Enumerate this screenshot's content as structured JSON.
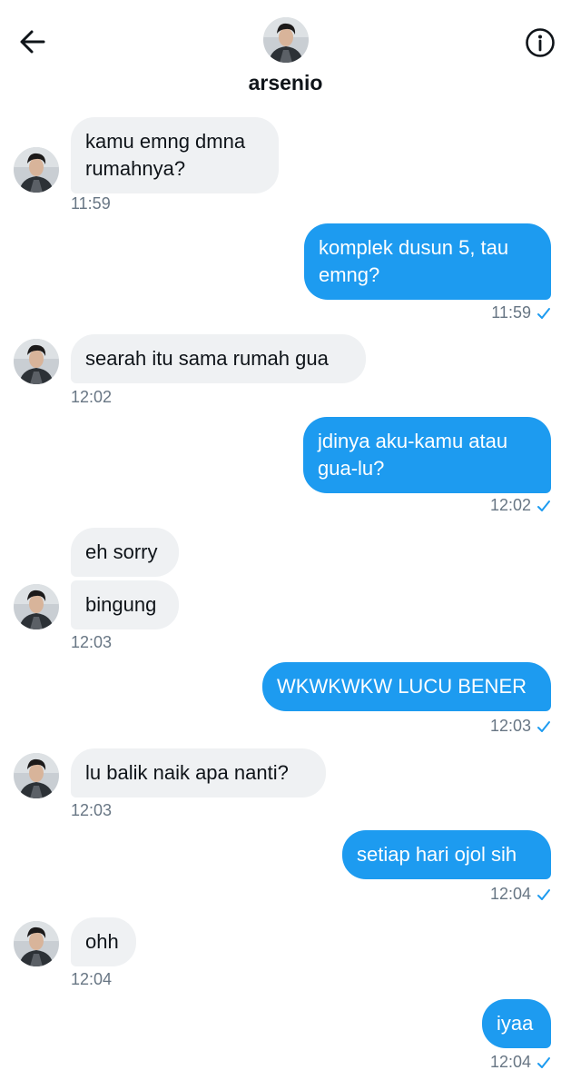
{
  "header": {
    "name": "arsenio"
  },
  "messages": [
    {
      "dir": "in",
      "text": "kamu emng dmna\nrumahnya?",
      "time": "11:59"
    },
    {
      "dir": "out",
      "text": "komplek dusun 5, tau\nemng?",
      "time": "11:59"
    },
    {
      "dir": "in",
      "text": "searah itu sama rumah gua",
      "time": "12:02"
    },
    {
      "dir": "out",
      "text": "jdinya aku-kamu atau\ngua-lu?",
      "time": "12:02"
    },
    {
      "dir": "in",
      "text": "eh sorry"
    },
    {
      "dir": "in",
      "text": "bingung",
      "time": "12:03"
    },
    {
      "dir": "out",
      "text": "WKWKWKW LUCU BENER",
      "time": "12:03"
    },
    {
      "dir": "in",
      "text": "lu balik naik apa nanti?",
      "time": "12:03"
    },
    {
      "dir": "out",
      "text": "setiap hari ojol sih",
      "time": "12:04"
    },
    {
      "dir": "in",
      "text": "ohh",
      "time": "12:04"
    },
    {
      "dir": "out",
      "text": "iyaa",
      "time": "12:04"
    }
  ],
  "colors": {
    "outgoing_bubble": "#1d9bf0",
    "incoming_bubble": "#eff1f3",
    "timestamp": "#687684",
    "read_check": "#1d9bf0"
  },
  "icons": {
    "back": "arrow-left-icon",
    "info": "info-icon",
    "read": "check-icon"
  }
}
